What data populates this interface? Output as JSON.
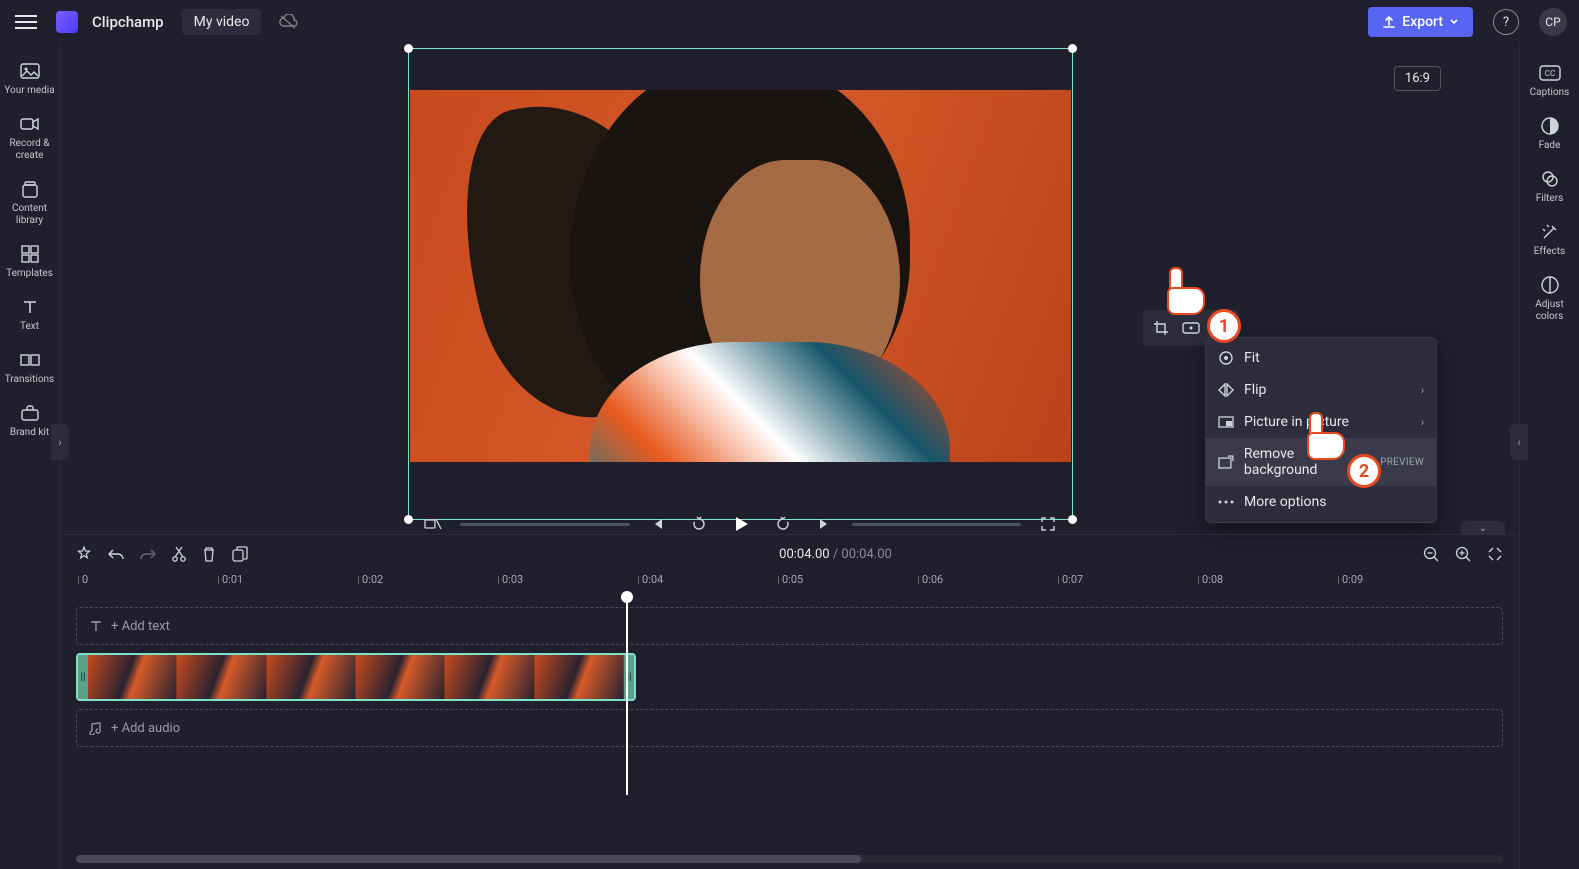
{
  "app": {
    "name": "Clipchamp",
    "project_title": "My video",
    "avatar": "CP"
  },
  "topbar": {
    "export_label": "Export"
  },
  "preview": {
    "ratio_label": "16:9"
  },
  "sidebar_left": {
    "items": [
      {
        "label": "Your media"
      },
      {
        "label": "Record & create"
      },
      {
        "label": "Content library"
      },
      {
        "label": "Templates"
      },
      {
        "label": "Text"
      },
      {
        "label": "Transitions"
      },
      {
        "label": "Brand kit"
      }
    ]
  },
  "sidebar_right": {
    "items": [
      {
        "label": "Captions"
      },
      {
        "label": "Fade"
      },
      {
        "label": "Filters"
      },
      {
        "label": "Effects"
      },
      {
        "label": "Adjust colors"
      }
    ]
  },
  "dropdown": {
    "fit": "Fit",
    "flip": "Flip",
    "pip": "Picture in picture",
    "remove_bg": "Remove background",
    "remove_bg_badge": "Preview",
    "more": "More options"
  },
  "callouts": {
    "one": "1",
    "two": "2"
  },
  "playback": {
    "current": "00:04.00",
    "separator": " / ",
    "duration": "00:04.00"
  },
  "timeline": {
    "ticks": [
      "0",
      "0:01",
      "0:02",
      "0:03",
      "0:04",
      "0:05",
      "0:06",
      "0:07",
      "0:08",
      "0:09"
    ],
    "add_text_label": "+ Add text",
    "add_audio_label": "+ Add audio"
  }
}
